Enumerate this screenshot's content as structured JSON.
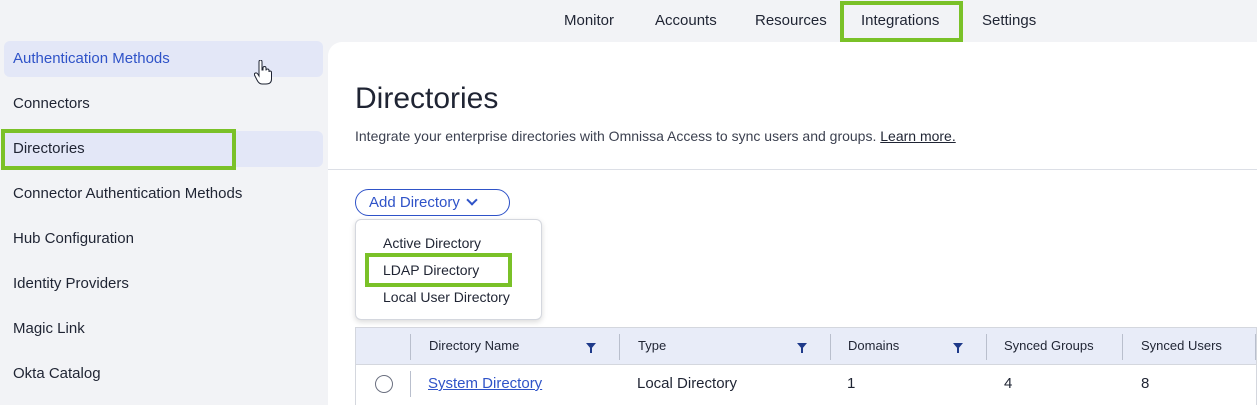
{
  "topnav": {
    "items": [
      "Monitor",
      "Accounts",
      "Resources",
      "Integrations",
      "Settings"
    ]
  },
  "sidebar": {
    "items": [
      "Authentication Methods",
      "Connectors",
      "Directories",
      "Connector Authentication Methods",
      "Hub Configuration",
      "Identity Providers",
      "Magic Link",
      "Okta Catalog"
    ]
  },
  "main": {
    "title": "Directories",
    "subtitle": "Integrate your enterprise directories with Omnissa Access to sync users and groups.",
    "learn_more": "Learn more.",
    "add_button": "Add Directory",
    "dropdown": [
      "Active Directory",
      "LDAP Directory",
      "Local User Directory"
    ]
  },
  "table": {
    "columns": [
      "Directory Name",
      "Type",
      "Domains",
      "Synced Groups",
      "Synced Users"
    ],
    "rows": [
      {
        "name": "System Directory",
        "type": "Local Directory",
        "domains": "1",
        "groups": "4",
        "users": "8"
      }
    ]
  },
  "colors": {
    "highlight": "#7ac128",
    "accent": "#2f53c8",
    "filter": "#1e3a8a"
  }
}
